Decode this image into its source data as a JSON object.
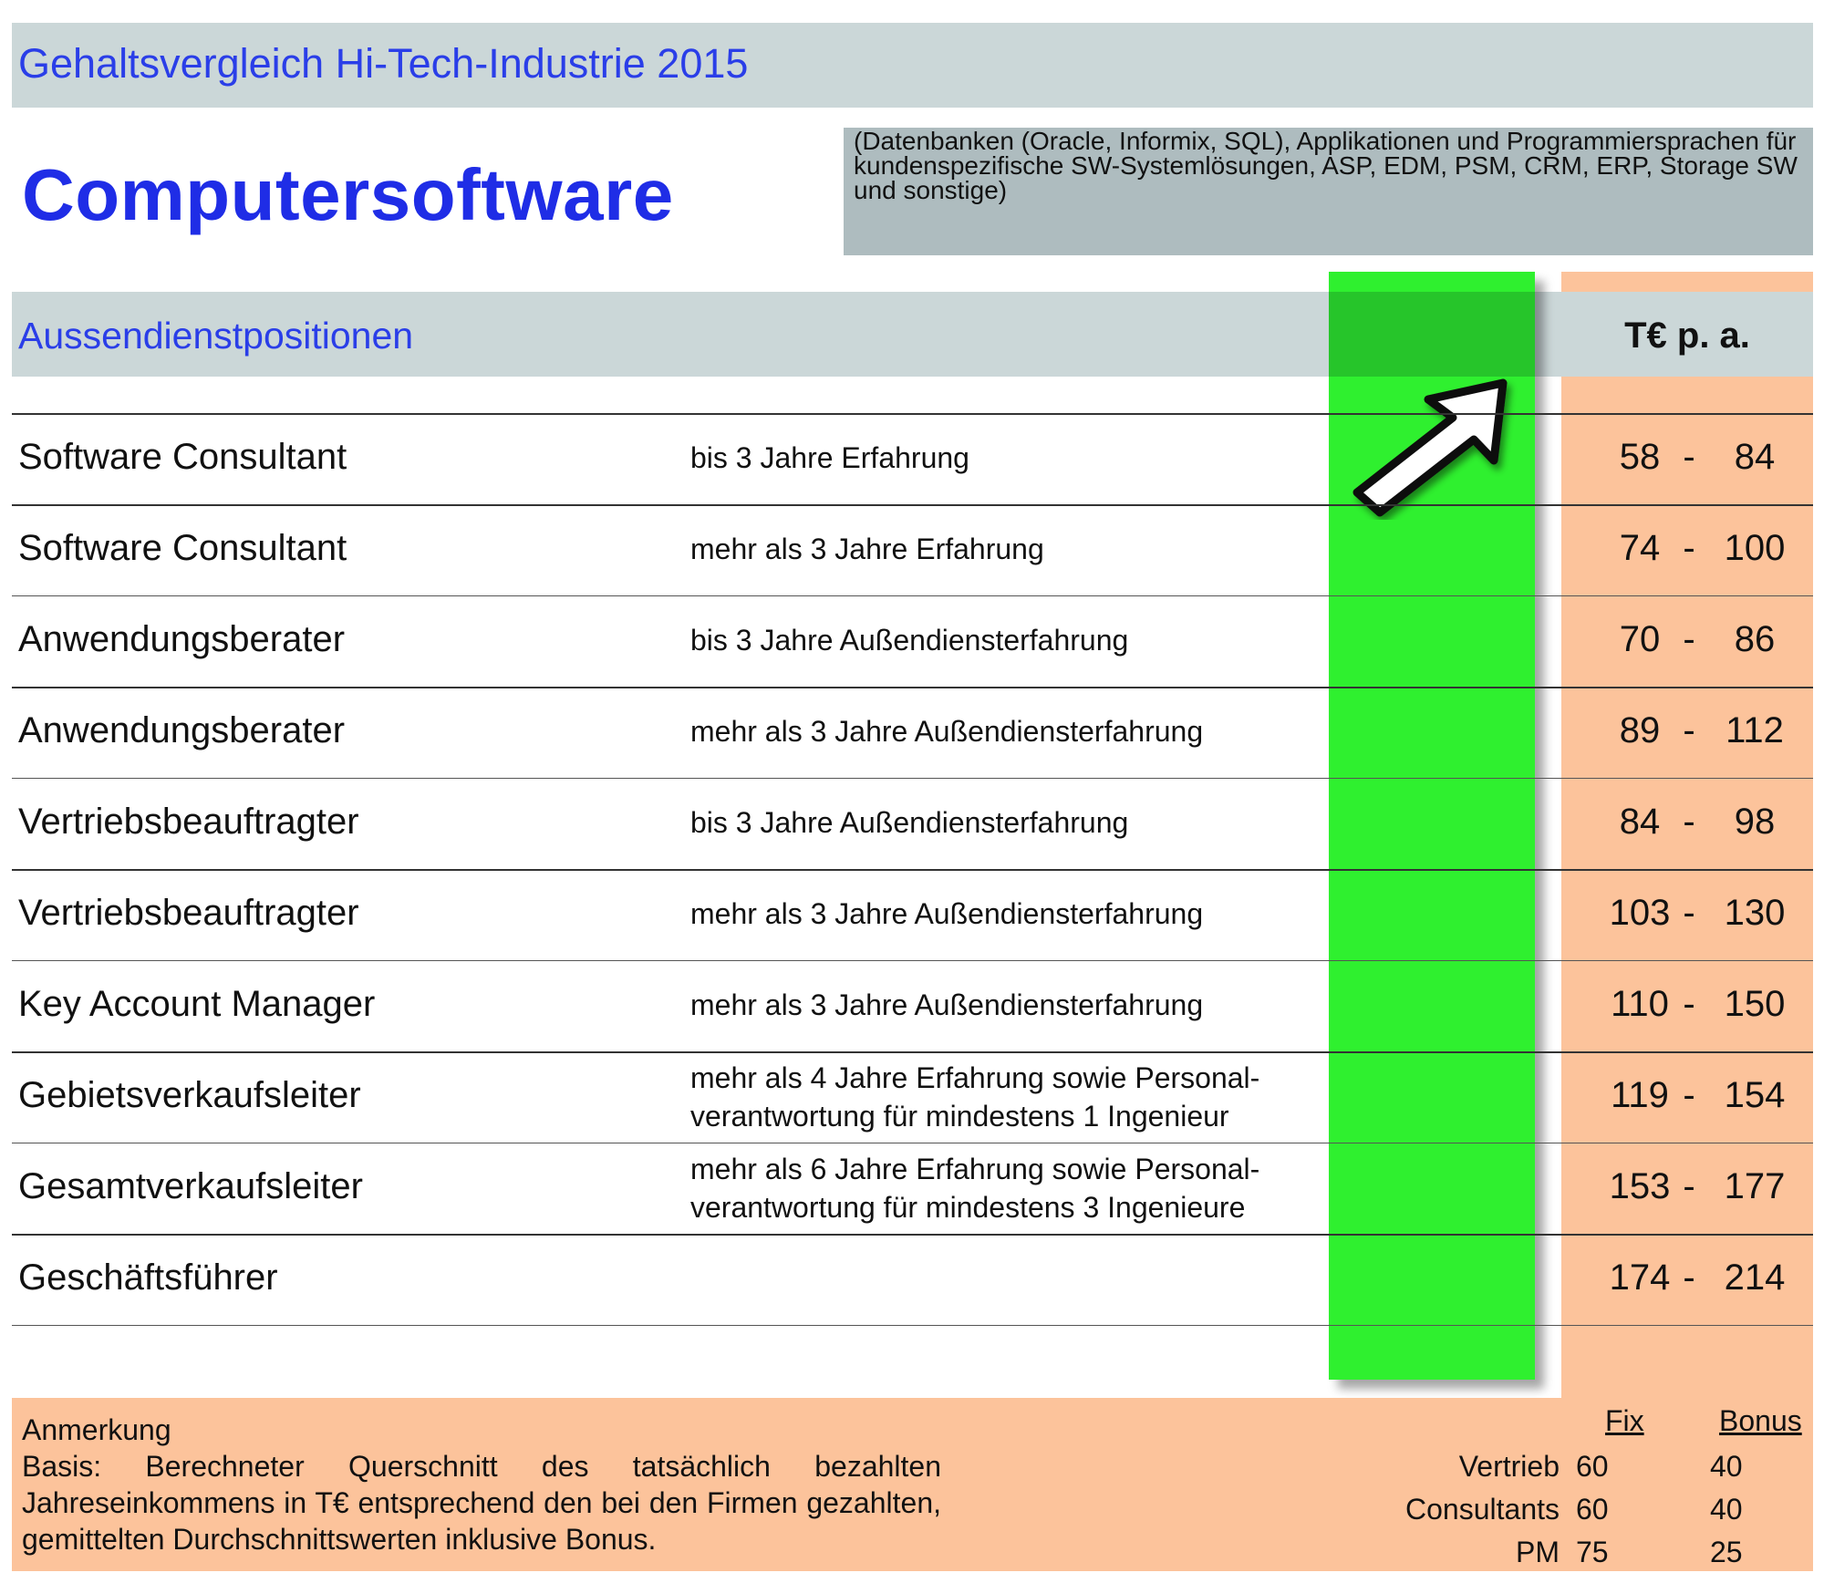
{
  "header": {
    "title": "Gehaltsvergleich Hi-Tech-Industrie 2015",
    "main_title": "Computersoftware",
    "description": "(Datenbanken (Oracle, Informix, SQL), Applikationen und Programmiersprachen für kundenspezifische SW-Systemlösungen, ASP, EDM, PSM, CRM, ERP, Storage SW und sonstige)"
  },
  "table": {
    "section_title": "Aussendienstpositionen",
    "unit_label": "T€ p. a.",
    "separator": "-",
    "rows": [
      {
        "position": "Software Consultant",
        "experience": [
          "bis 3 Jahre Erfahrung"
        ],
        "min": "58",
        "max": "84"
      },
      {
        "position": "Software Consultant",
        "experience": [
          "mehr als 3 Jahre Erfahrung"
        ],
        "min": "74",
        "max": "100"
      },
      {
        "position": "Anwendungsberater",
        "experience": [
          "bis 3 Jahre Außendiensterfahrung"
        ],
        "min": "70",
        "max": "86"
      },
      {
        "position": "Anwendungsberater",
        "experience": [
          "mehr als 3 Jahre Außendiensterfahrung"
        ],
        "min": "89",
        "max": "112"
      },
      {
        "position": "Vertriebsbeauftragter",
        "experience": [
          "bis 3 Jahre Außendiensterfahrung"
        ],
        "min": "84",
        "max": "98"
      },
      {
        "position": "Vertriebsbeauftragter",
        "experience": [
          "mehr als 3 Jahre Außendiensterfahrung"
        ],
        "min": "103",
        "max": "130"
      },
      {
        "position": "Key Account Manager",
        "experience": [
          "mehr als 3 Jahre Außendiensterfahrung"
        ],
        "min": "110",
        "max": "150"
      },
      {
        "position": "Gebietsverkaufsleiter",
        "experience": [
          "mehr als 4 Jahre Erfahrung sowie Personal-",
          "verantwortung für mindestens 1 Ingenieur"
        ],
        "min": "119",
        "max": "154"
      },
      {
        "position": "Gesamtverkaufsleiter",
        "experience": [
          "mehr als 6 Jahre Erfahrung sowie Personal-",
          "verantwortung für mindestens 3 Ingenieure"
        ],
        "min": "153",
        "max": "177"
      },
      {
        "position": "Geschäftsführer",
        "experience": [],
        "min": "174",
        "max": "214"
      }
    ]
  },
  "note": {
    "title": "Anmerkung",
    "body": "Basis: Berechneter Querschnitt des tatsächlich bezahlten Jahreseinkommens in T€ entsprechend den bei den Firmen gezahlten, gemittelten Durchschnittswerten inklusive Bonus."
  },
  "split": {
    "headers": {
      "fix": "Fix",
      "bonus": "Bonus"
    },
    "rows": [
      {
        "label": "Vertrieb",
        "fix": "60",
        "bonus": "40"
      },
      {
        "label": "Consultants",
        "fix": "60",
        "bonus": "40"
      },
      {
        "label": "PM",
        "fix": "75",
        "bonus": "25"
      }
    ]
  },
  "colors": {
    "title_blue": "#2a3ee8",
    "header_gray": "#cbd7d8",
    "highlight_green": "#2ff02f",
    "salary_orange": "#fcc39b"
  },
  "icons": {
    "arrow": "arrow-up-right-icon"
  }
}
